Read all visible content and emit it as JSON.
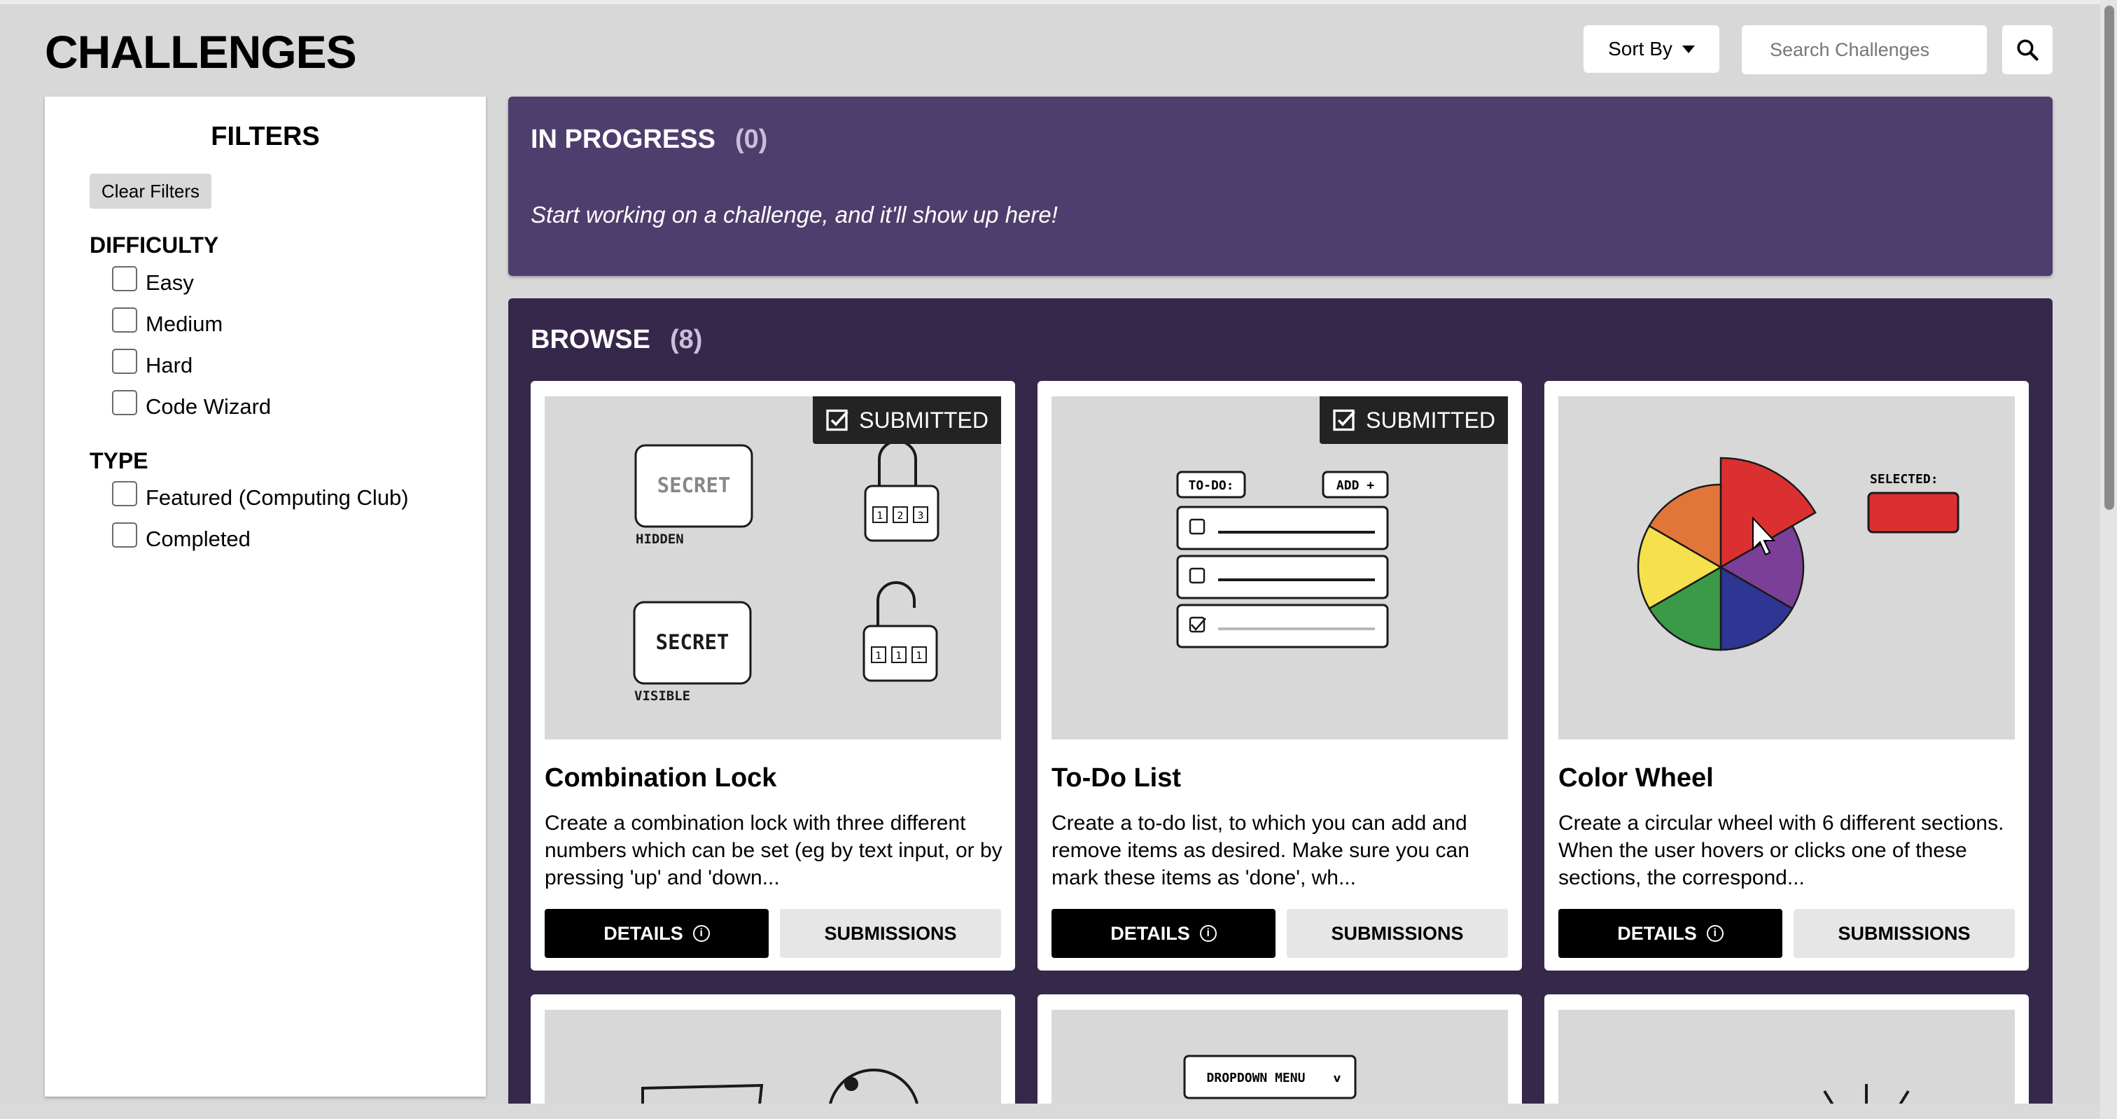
{
  "page": {
    "title": "CHALLENGES"
  },
  "toolbar": {
    "sort_label": "Sort By",
    "search_placeholder": "Search Challenges"
  },
  "filters": {
    "title": "FILTERS",
    "clear_label": "Clear Filters",
    "difficulty": {
      "heading": "DIFFICULTY",
      "options": [
        "Easy",
        "Medium",
        "Hard",
        "Code Wizard"
      ]
    },
    "type": {
      "heading": "TYPE",
      "options": [
        "Featured (Computing Club)",
        "Completed"
      ]
    }
  },
  "in_progress": {
    "title": "IN PROGRESS",
    "count": "(0)",
    "empty_message": "Start working on a challenge, and it'll show up here!"
  },
  "browse": {
    "title": "BROWSE",
    "count": "(8)",
    "details_label": "DETAILS",
    "submissions_label": "SUBMISSIONS",
    "badge_label": "SUBMITTED",
    "cards": [
      {
        "title": "Combination Lock",
        "description": "Create a combination lock with three different numbers which can be set (eg by text input, or by pressing 'up' and 'down...",
        "submitted": true,
        "illustration": {
          "secret_word": "SECRET",
          "hidden_label": "HIDDEN",
          "visible_label": "VISIBLE",
          "locked_digits": [
            "1",
            "2",
            "3"
          ],
          "unlocked_digits": [
            "1",
            "1",
            "1"
          ]
        }
      },
      {
        "title": "To-Do List",
        "description": "Create a to-do list, to which you can add and remove items as desired. Make sure you can mark these items as 'done', wh...",
        "submitted": true,
        "illustration": {
          "todo_label": "TO-DO:",
          "add_label": "ADD +"
        }
      },
      {
        "title": "Color Wheel",
        "description": "Create a circular wheel with 6 different sections. When the user hovers or clicks one of these sections, the correspond...",
        "submitted": false,
        "illustration": {
          "selected_label": "SELECTED:",
          "selected_color": "#dc3030",
          "wheel_colors": [
            "#dc3030",
            "#7b3f98",
            "#2e3592",
            "#3a9a48",
            "#f5e04d",
            "#e2763a"
          ]
        }
      }
    ],
    "partial_cards": [
      {
        "illustration": "pot-timer"
      },
      {
        "illustration": "dropdown",
        "dropdown_label": "DROPDOWN MENU"
      },
      {
        "illustration": "starburst"
      }
    ]
  },
  "colors": {
    "background": "#d8d8d8",
    "in_progress_bg": "#4e3e6d",
    "browse_bg": "#35284b",
    "details_button": "#000000",
    "submissions_button": "#e6e6e6"
  }
}
